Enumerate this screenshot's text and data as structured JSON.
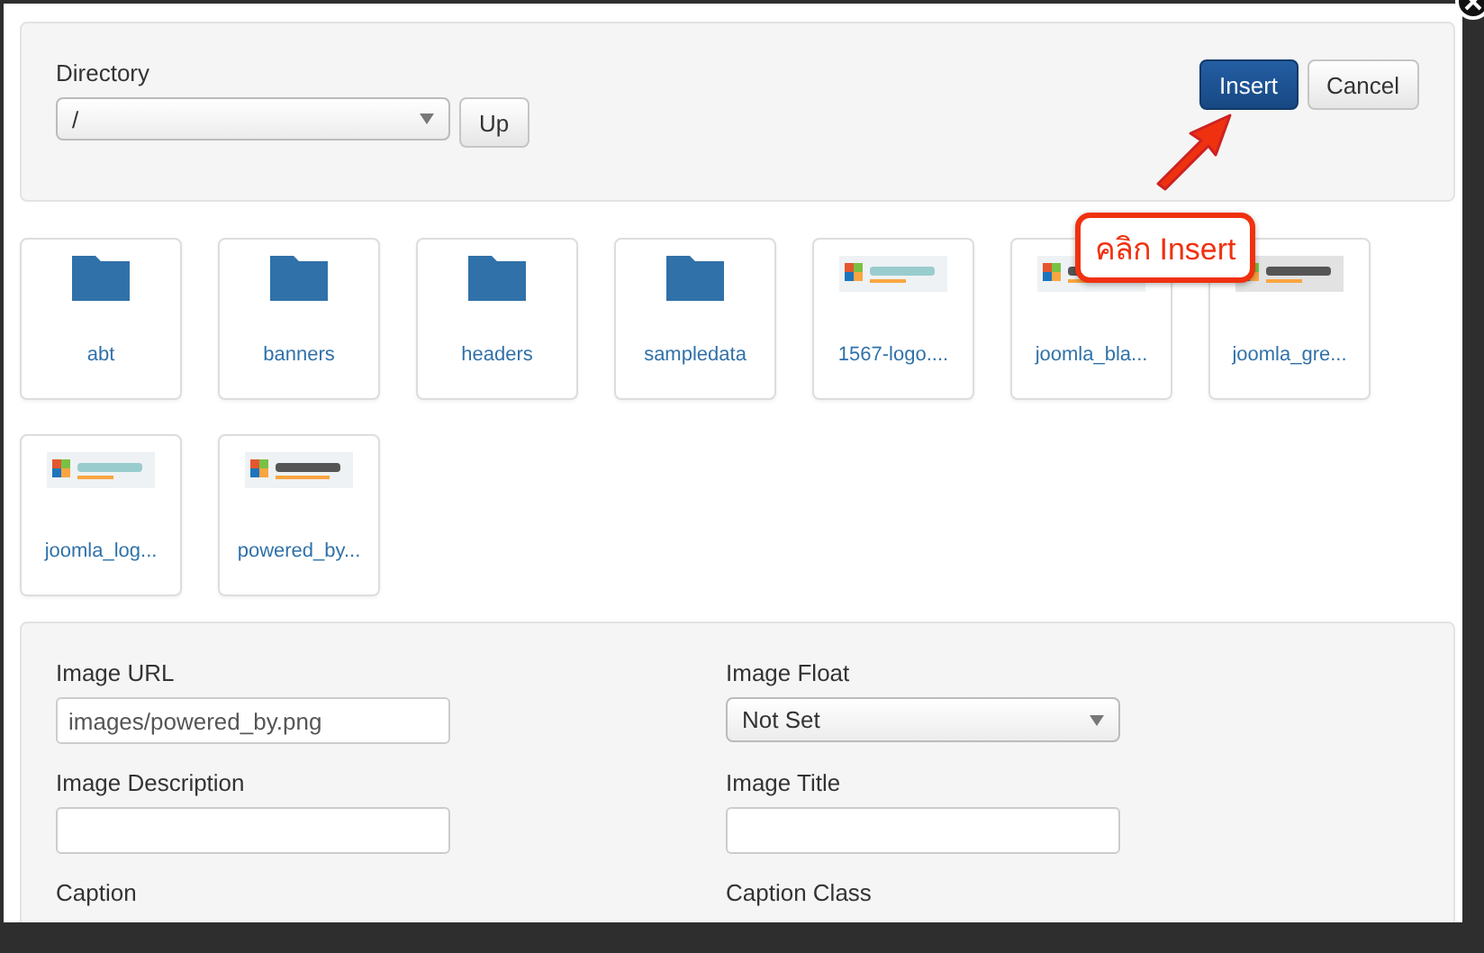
{
  "directory": {
    "label": "Directory",
    "value": "/",
    "up_button": "Up"
  },
  "buttons": [
    {
      "label": "Insert",
      "kind": "primary"
    },
    {
      "label": "Cancel",
      "kind": "default"
    }
  ],
  "annotation": {
    "text": "คลิก Insert"
  },
  "files": [
    {
      "name": "abt",
      "kind": "folder"
    },
    {
      "name": "banners",
      "kind": "folder"
    },
    {
      "name": "headers",
      "kind": "folder"
    },
    {
      "name": "sampledata",
      "kind": "folder"
    },
    {
      "name": "1567-logo...."
    },
    {
      "name": "joomla_bla..."
    },
    {
      "name": "joomla_gre..."
    },
    {
      "name": "joomla_log..."
    },
    {
      "name": "powered_by..."
    }
  ],
  "fields": [
    {
      "label": "Image URL",
      "kind": "text",
      "value": "images/powered_by.png"
    },
    {
      "label": "Image Float",
      "kind": "select",
      "value": "Not Set"
    },
    {
      "label": "Image Description",
      "kind": "text"
    },
    {
      "label": "Image Title",
      "kind": "text"
    },
    {
      "label": "Caption",
      "kind": "cut"
    },
    {
      "label": "Caption Class",
      "kind": "cut"
    }
  ]
}
